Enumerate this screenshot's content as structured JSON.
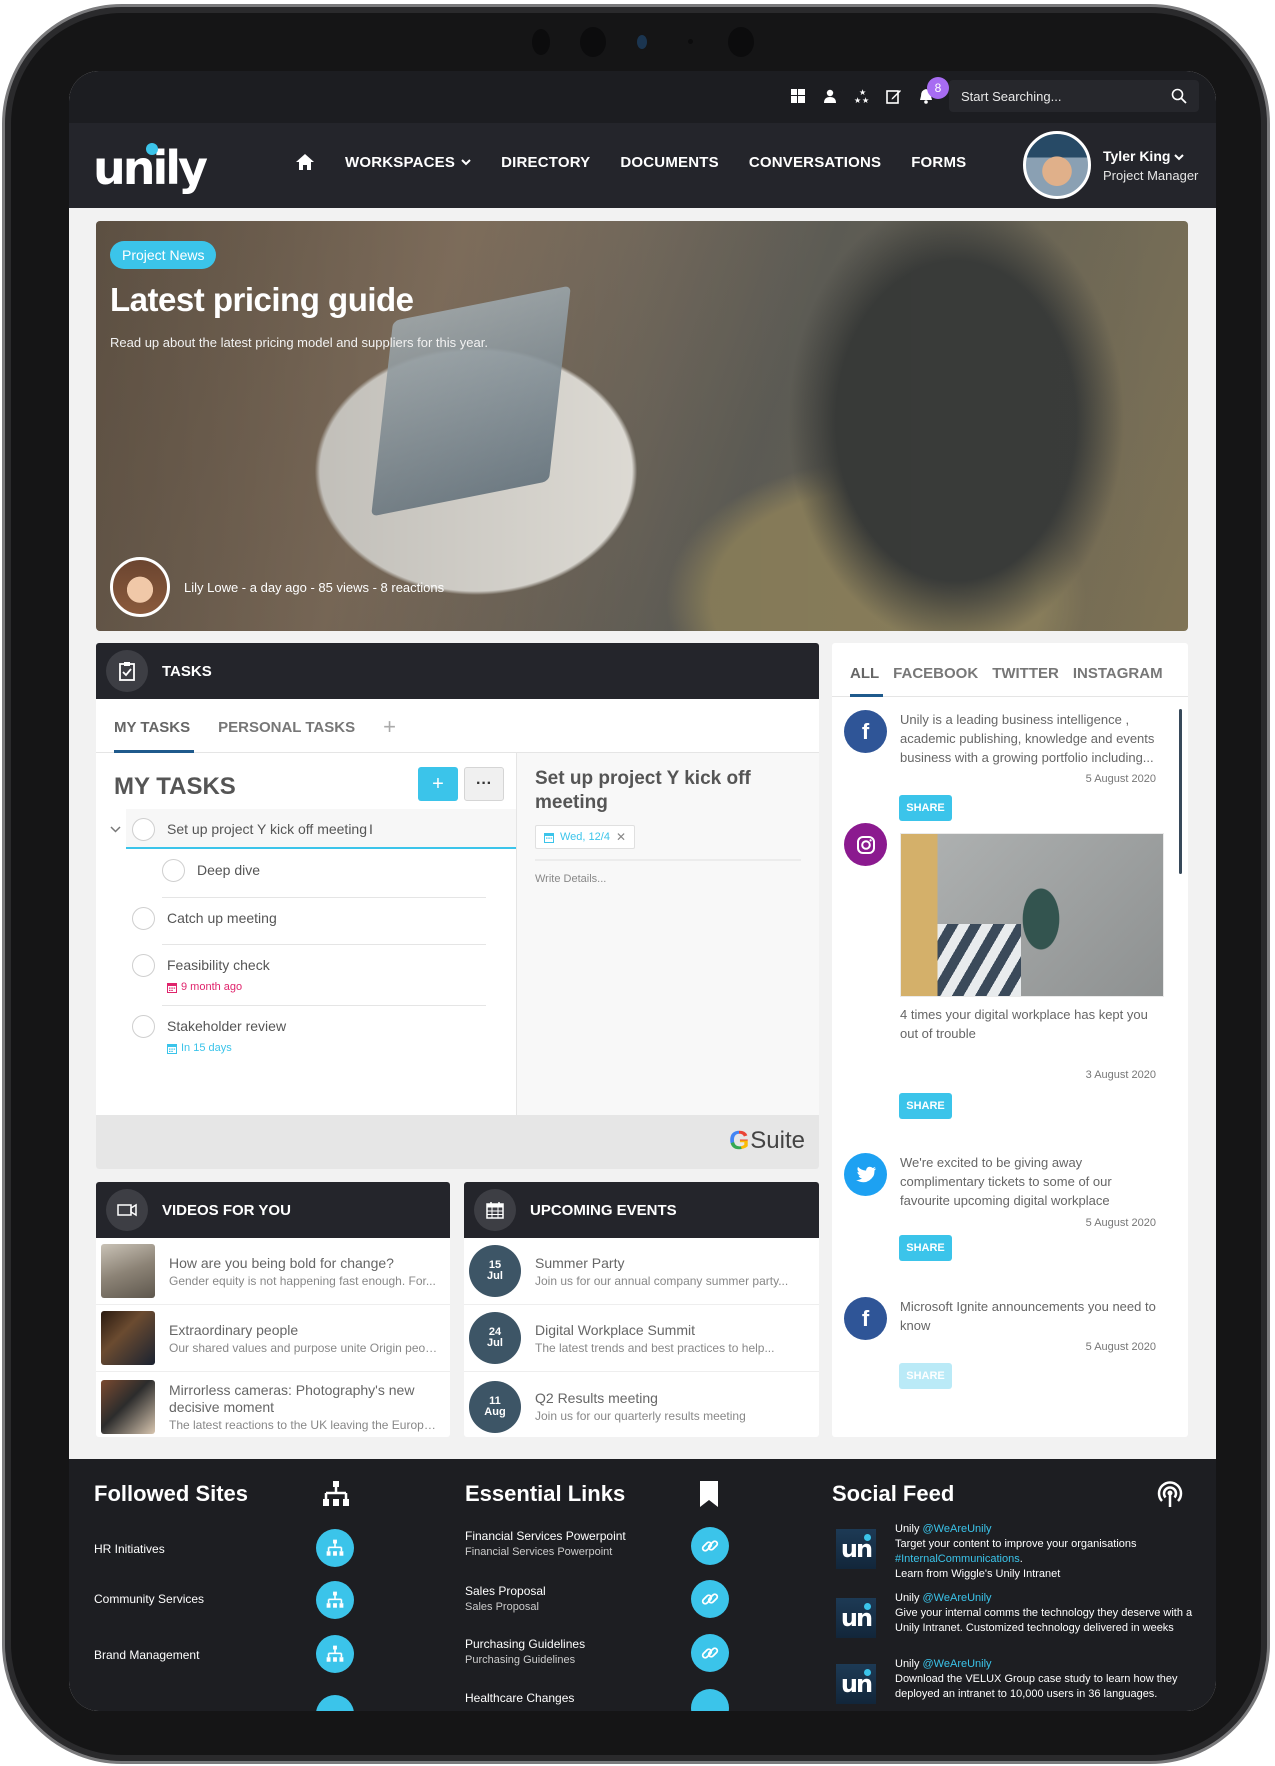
{
  "topbar": {
    "icons": [
      "windows-icon",
      "user-icon",
      "stars-icon",
      "edit-icon",
      "bell-icon"
    ],
    "notification_count": "8",
    "search_placeholder": "Start Searching..."
  },
  "nav": {
    "logo": "unily",
    "items": [
      {
        "label": "WORKSPACES",
        "dropdown": true
      },
      {
        "label": "DIRECTORY"
      },
      {
        "label": "DOCUMENTS"
      },
      {
        "label": "CONVERSATIONS"
      },
      {
        "label": "FORMS"
      }
    ],
    "user": {
      "name": "Tyler King",
      "role": "Project Manager"
    }
  },
  "hero": {
    "tag": "Project News",
    "title": "Latest pricing guide",
    "subtitle": "Read up about the latest pricing model and suppliers for this year.",
    "meta": "Lily Lowe - a day ago - 85 views - 8 reactions"
  },
  "tasks": {
    "header": "TASKS",
    "tabs": [
      "MY TASKS",
      "PERSONAL TASKS"
    ],
    "active_tab": "MY TASKS",
    "add_tab_label": "+",
    "list_title": "MY TASKS",
    "add_label": "+",
    "more_label": "···",
    "items": [
      {
        "label": "Set up project Y kick off meeting",
        "expanded": true,
        "selected": true
      },
      {
        "label": "Deep dive",
        "subtask": true
      },
      {
        "label": "Catch up meeting"
      },
      {
        "label": "Feasibility check",
        "due": "9 month ago",
        "due_color": "#e0246c"
      },
      {
        "label": "Stakeholder review",
        "due": "In 15 days",
        "due_color": "#3bc4ea"
      }
    ],
    "detail": {
      "title": "Set up project Y kick off meeting",
      "date": "Wed, 12/4",
      "details_placeholder": "Write Details..."
    },
    "footer_brand": "Suite"
  },
  "social": {
    "tabs": [
      "ALL",
      "FACEBOOK",
      "TWITTER",
      "INSTAGRAM"
    ],
    "active_tab": "ALL",
    "share_label": "SHARE",
    "posts": [
      {
        "network": "facebook",
        "text": "Unily is a leading business intelligence , academic publishing, knowledge and events business with a growing portfolio including...",
        "date": "5 August 2020"
      },
      {
        "network": "instagram",
        "text": "4 times your digital workplace has kept you out of trouble",
        "date": "3 August 2020"
      },
      {
        "network": "twitter",
        "text": "We're excited to be giving away complimentary tickets to some of our favourite upcoming digital workplace",
        "date": "5 August 2020"
      },
      {
        "network": "facebook",
        "text": "Microsoft Ignite announcements you need to know",
        "date": "5 August 2020"
      }
    ]
  },
  "videos": {
    "header": "VIDEOS FOR YOU",
    "items": [
      {
        "title": "How are you being bold for change?",
        "desc": "Gender equity is not happening fast enough. For..."
      },
      {
        "title": "Extraordinary people",
        "desc": "Our shared values and purpose unite Origin people..."
      },
      {
        "title": "Mirrorless cameras: Photography's new decisive moment",
        "desc": "The latest reactions to the UK leaving the European..."
      }
    ]
  },
  "events": {
    "header": "UPCOMING EVENTS",
    "items": [
      {
        "day": "15",
        "month": "Jul",
        "title": "Summer Party",
        "desc": "Join us for our annual company summer party..."
      },
      {
        "day": "24",
        "month": "Jul",
        "title": "Digital Workplace Summit",
        "desc": "The latest trends and best practices to help..."
      },
      {
        "day": "11",
        "month": "Aug",
        "title": "Q2 Results meeting",
        "desc": "Join us for our quarterly results meeting"
      }
    ]
  },
  "footer": {
    "followed_sites": {
      "title": "Followed Sites",
      "items": [
        "HR Initiatives",
        "Community Services",
        "Brand Management"
      ]
    },
    "essential_links": {
      "title": "Essential Links",
      "items": [
        {
          "title": "Financial Services Powerpoint",
          "sub": "Financial Services Powerpoint"
        },
        {
          "title": "Sales Proposal",
          "sub": "Sales Proposal"
        },
        {
          "title": "Purchasing Guidelines",
          "sub": "Purchasing Guidelines"
        },
        {
          "title": "Healthcare Changes",
          "sub": ""
        }
      ]
    },
    "social_feed": {
      "title": "Social Feed",
      "items": [
        {
          "author": "Unily",
          "handle": "@WeAreUnily",
          "text": "Target your content to improve your organisations",
          "hashtag": "#InternalCommunications",
          "text2": "Learn from Wiggle's Unily Intranet"
        },
        {
          "author": "Unily",
          "handle": "@WeAreUnily",
          "text": "Give your internal comms the technology they deserve with a Unily Intranet. Customized technology delivered in weeks"
        },
        {
          "author": "Unily",
          "handle": "@WeAreUnily",
          "text": "Download the VELUX Group case study to learn how they deployed an intranet to 10,000 users in 36 languages."
        }
      ]
    }
  },
  "colors": {
    "accent": "#3bc4ea",
    "dark": "#24252b",
    "badge": "#a76cf2",
    "facebook": "#2f5597",
    "twitter": "#1da1f2",
    "instagram": "#8b1a8f",
    "overdue": "#e0246c"
  }
}
